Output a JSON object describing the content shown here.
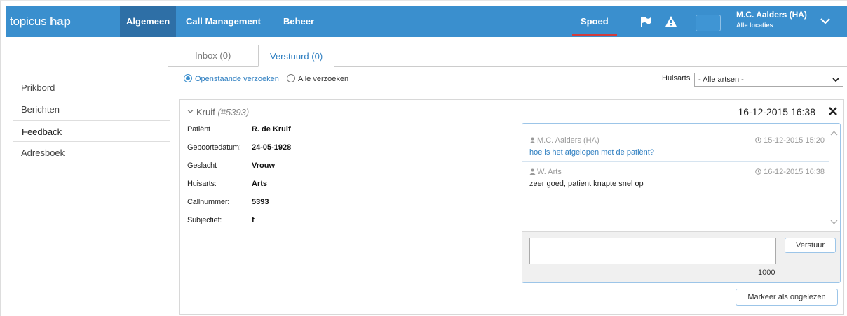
{
  "header": {
    "logo_brand": "topicus",
    "logo_sub": "hap",
    "nav": [
      "Algemeen",
      "Call Management",
      "Beheer"
    ],
    "spoed": "Spoed",
    "user_name": "M.C. Aalders (HA)",
    "user_location": "Alle locaties"
  },
  "sidebar": {
    "items": [
      "Prikbord",
      "Berichten",
      "Feedback",
      "Adresboek"
    ],
    "active": "Feedback"
  },
  "tabs": {
    "inbox": "Inbox (0)",
    "sent": "Verstuurd (0)"
  },
  "filters": {
    "open": "Openstaande verzoeken",
    "all": "Alle verzoeken",
    "doctor_label": "Huisarts",
    "doctor_value": "- Alle artsen -"
  },
  "card": {
    "name": "Kruif",
    "number": "(#5393)",
    "datetime": "16-12-2015 16:38",
    "details": [
      {
        "label": "Patiënt",
        "value": "R. de Kruif"
      },
      {
        "label": "Geboortedatum:",
        "value": "24-05-1928"
      },
      {
        "label": "Geslacht",
        "value": "Vrouw"
      },
      {
        "label": "Huisarts:",
        "value": "Arts"
      },
      {
        "label": "Callnummer:",
        "value": "5393"
      },
      {
        "label": "Subjectief:",
        "value": "f"
      }
    ]
  },
  "chat": {
    "messages": [
      {
        "author": "M.C. Aalders (HA)",
        "time": "15-12-2015 15:20",
        "text": "hoe is het afgelopen met de patiënt?"
      },
      {
        "author": "W. Arts",
        "time": "16-12-2015 16:38",
        "text": "zeer goed, patient knapte snel op"
      }
    ],
    "send_label": "Verstuur",
    "char_count": "1000",
    "mark_unread": "Markeer als ongelezen"
  },
  "colors": {
    "header_bg": "#3a8fce",
    "header_active": "#2e6fa6",
    "spoed_accent": "#d23c3c",
    "link_blue": "#2f7fc1",
    "panel_border": "#9cc5e8"
  }
}
